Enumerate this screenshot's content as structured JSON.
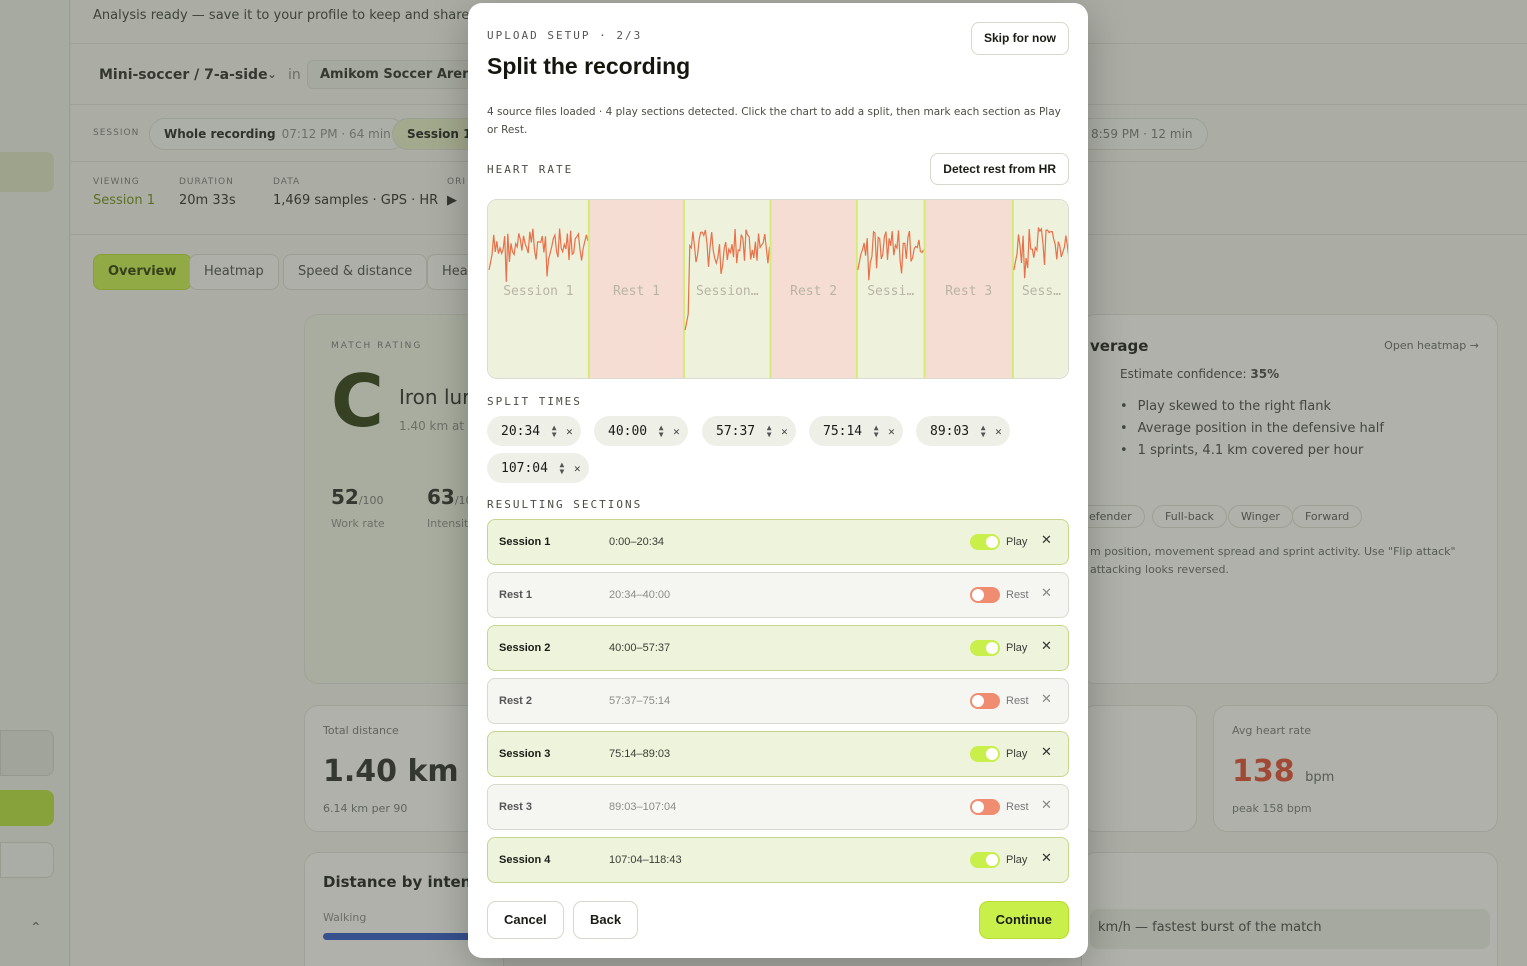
{
  "background": {
    "banner": "Analysis ready — save it to your profile to keep and share it.",
    "sport": "Mini-soccer / 7-a-side",
    "in_word": "in",
    "venue": "Amikom Soccer Arena",
    "session_label": "SESSION",
    "whole": {
      "name": "Whole recording",
      "meta": "07:12 PM · 64 min"
    },
    "session1_chip": "Session 1",
    "right_chip": "8:59 PM · 12 min",
    "stats": [
      {
        "k": "VIEWING",
        "v": "Session 1"
      },
      {
        "k": "DURATION",
        "v": "20m 33s"
      },
      {
        "k": "DATA",
        "v": "1,469 samples · GPS · HR"
      },
      {
        "k": "ORI",
        "v": "▶"
      }
    ],
    "tabs": [
      "Overview",
      "Heatmap",
      "Speed & distance",
      "Hear"
    ],
    "rating": {
      "label": "MATCH RATING",
      "grade": "C",
      "name": "Iron lur",
      "sub": "1.40 km at d",
      "work_val": "52",
      "work_den": "/100",
      "work_cap": "Work rate",
      "int_val": "63",
      "int_den": "/10",
      "int_cap": "Intensity"
    },
    "coverage": {
      "title": "verage",
      "link": "Open heatmap →",
      "conf_label": "Estimate confidence:",
      "conf_value": "35%",
      "bullets": [
        "Play skewed to the right flank",
        "Average position in the defensive half",
        "1 sprints, 4.1 km covered per hour"
      ],
      "positions": [
        "efender",
        "Full-back",
        "Winger",
        "Forward"
      ],
      "note": "m position, movement spread and sprint activity. Use \"Flip attack\" attacking looks reversed."
    },
    "distance": {
      "k": "Total distance",
      "v": "1.40 km",
      "sub": "6.14 km per 90"
    },
    "hr": {
      "k": "Avg heart rate",
      "v": "138",
      "unit": "bpm",
      "sub": "peak 158 bpm"
    },
    "intensity": {
      "title": "Distance by intensit",
      "walk": "Walking"
    },
    "sprint": "km/h — fastest burst of the match"
  },
  "modal": {
    "eyebrow": "UPLOAD SETUP · 2/3",
    "skip": "Skip for now",
    "title": "Split the recording",
    "description": "4 source files loaded · 4 play sections detected. Click the chart to add a split, then mark each section as Play or Rest.",
    "heart_rate_label": "HEART RATE",
    "detect_button": "Detect rest from HR",
    "split_times_label": "SPLIT TIMES",
    "splits": [
      "20:34",
      "40:00",
      "57:37",
      "75:14",
      "89:03",
      "107:04"
    ],
    "resulting_label": "RESULTING SECTIONS",
    "sections": [
      {
        "name": "Session 1",
        "range": "0:00–20:34",
        "state": "Play"
      },
      {
        "name": "Rest 1",
        "range": "20:34–40:00",
        "state": "Rest"
      },
      {
        "name": "Session 2",
        "range": "40:00–57:37",
        "state": "Play"
      },
      {
        "name": "Rest 2",
        "range": "57:37–75:14",
        "state": "Rest"
      },
      {
        "name": "Session 3",
        "range": "75:14–89:03",
        "state": "Play"
      },
      {
        "name": "Rest 3",
        "range": "89:03–107:04",
        "state": "Rest"
      },
      {
        "name": "Session 4",
        "range": "107:04–118:43",
        "state": "Play"
      }
    ],
    "buttons": {
      "cancel": "Cancel",
      "back": "Back",
      "continue": "Continue"
    }
  },
  "chart_data": {
    "type": "line",
    "title": "HEART RATE",
    "x_unit": "min",
    "xlim": [
      0,
      118.72
    ],
    "regions": [
      {
        "label": "Session 1",
        "start": 0,
        "end": 20.57,
        "kind": "play"
      },
      {
        "label": "Rest 1",
        "start": 20.57,
        "end": 40.0,
        "kind": "rest"
      },
      {
        "label": "Session 2",
        "start": 40.0,
        "end": 57.62,
        "kind": "play"
      },
      {
        "label": "Rest 2",
        "start": 57.62,
        "end": 75.23,
        "kind": "rest"
      },
      {
        "label": "Session 3",
        "start": 75.23,
        "end": 89.05,
        "kind": "play"
      },
      {
        "label": "Rest 3",
        "start": 89.05,
        "end": 107.07,
        "kind": "rest"
      },
      {
        "label": "Session 4",
        "start": 107.07,
        "end": 118.72,
        "kind": "play"
      }
    ],
    "colors": {
      "play": "#eef2dc",
      "rest": "#f5ddd4",
      "line": "#e8704a",
      "label": "#b9b3a5",
      "divider": "#d6ea7a"
    }
  }
}
